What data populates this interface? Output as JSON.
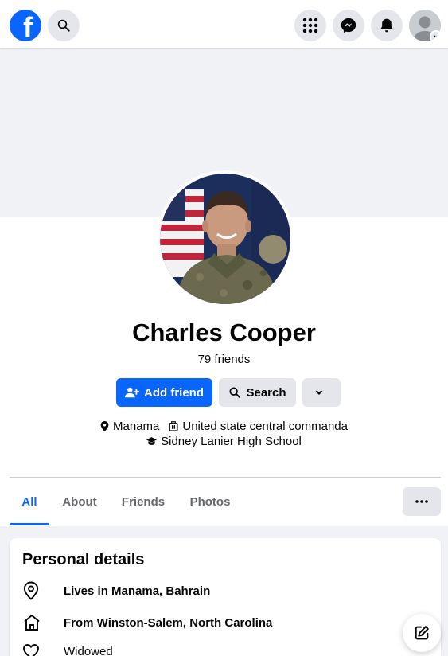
{
  "topbar": {
    "logo_letter": "f",
    "icons": [
      "search-icon",
      "menu-grid-icon",
      "messenger-icon",
      "notifications-icon",
      "account-icon"
    ]
  },
  "profile": {
    "name": "Charles Cooper",
    "friends_count": "79 friends",
    "buttons": {
      "add_friend": "Add friend",
      "search": "Search"
    },
    "info": {
      "location": "Manama",
      "work": "United state central commanda",
      "school": "Sidney Lanier High School"
    }
  },
  "tabs": [
    {
      "label": "All",
      "active": true
    },
    {
      "label": "About",
      "active": false
    },
    {
      "label": "Friends",
      "active": false
    },
    {
      "label": "Photos",
      "active": false
    }
  ],
  "personal_details": {
    "title": "Personal details",
    "items": [
      {
        "icon": "location-pin-icon",
        "text": "Lives in Manama, Bahrain"
      },
      {
        "icon": "home-icon",
        "text": "From Winston-Salem, North Carolina"
      },
      {
        "icon": "heart-icon",
        "text": "Widowed"
      }
    ]
  },
  "colors": {
    "accent": "#0866ff",
    "button_gray": "#e4e6eb",
    "page_bg": "#f0f2f5",
    "text_primary": "#050505",
    "text_secondary": "#65676b"
  }
}
